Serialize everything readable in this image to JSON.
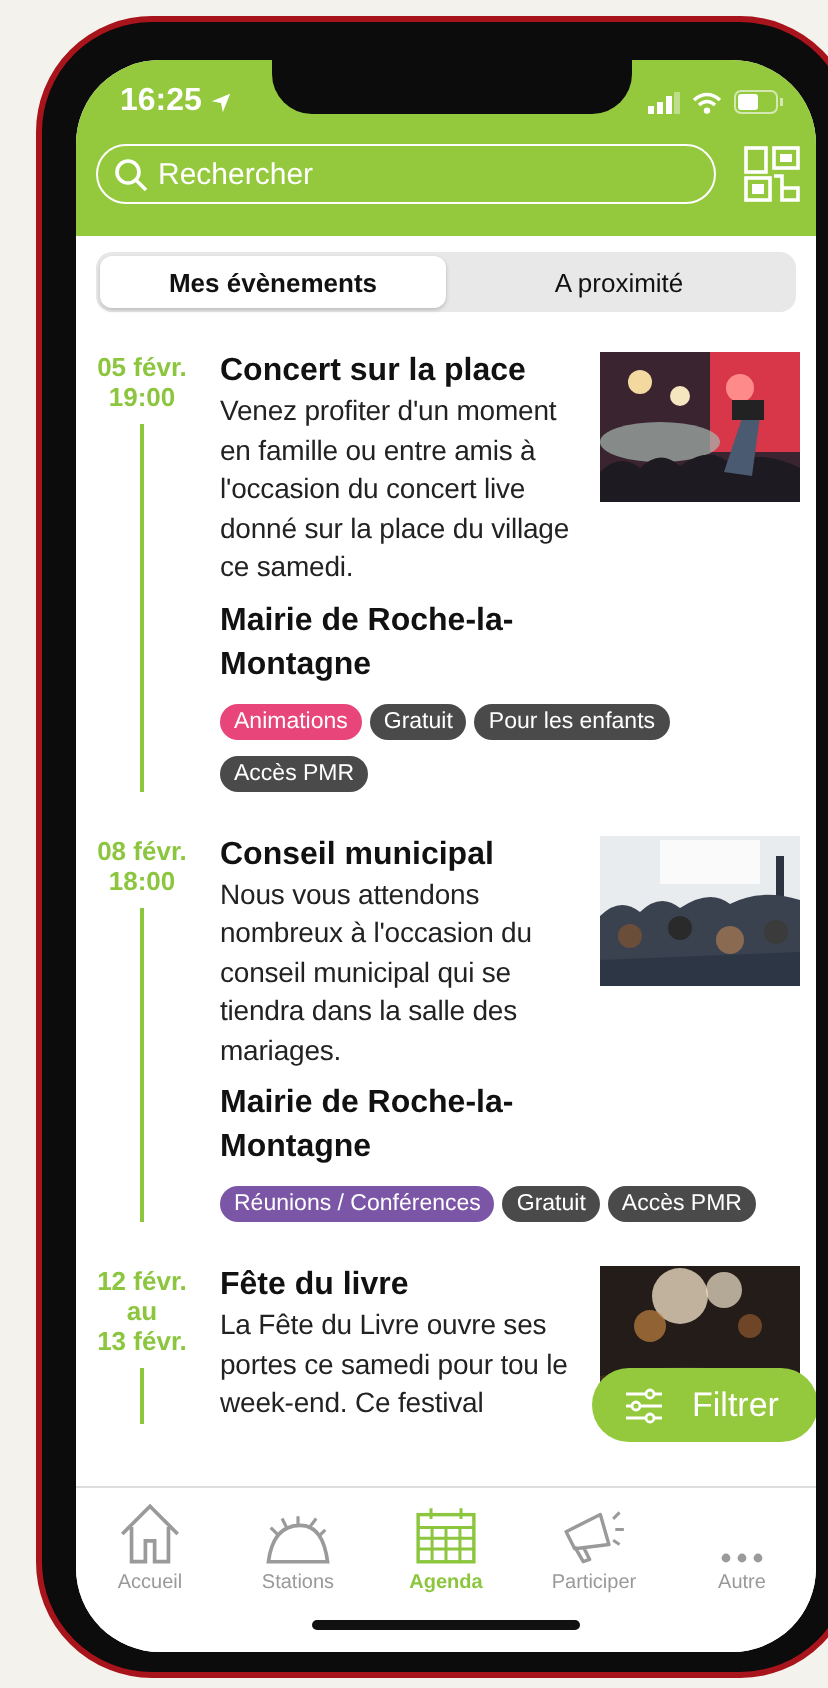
{
  "status_bar": {
    "time": "16:25"
  },
  "search": {
    "placeholder": "Rechercher"
  },
  "segments": [
    {
      "label": "Mes évènements",
      "selected": true
    },
    {
      "label": "A proximité",
      "selected": false
    }
  ],
  "events": [
    {
      "date": "05 févr.",
      "time": "19:00",
      "title": "Concert sur la place",
      "description": "Venez profiter d'un moment en famille ou entre amis à l'occasion du concert live donné sur la place du village ce samedi.",
      "organizer": "Mairie de Roche-la-Montagne",
      "tags": [
        {
          "label": "Animations",
          "color": "#e8457a"
        },
        {
          "label": "Gratuit",
          "color": "#4a4a4a"
        },
        {
          "label": "Pour les enfants",
          "color": "#4a4a4a"
        },
        {
          "label": "Accès PMR",
          "color": "#4a4a4a"
        }
      ],
      "image": {
        "kind": "picture"
      }
    },
    {
      "date": "08 févr.",
      "time": "18:00",
      "title": "Conseil municipal",
      "description": "Nous vous attendons nombreux à l'occasion du conseil municipal qui se tiendra dans la salle des mariages.",
      "organizer": "Mairie de Roche-la-Montagne",
      "tags": [
        {
          "label": "Réunions / Conférences",
          "color": "#7b55a6"
        },
        {
          "label": "Gratuit",
          "color": "#4a4a4a"
        },
        {
          "label": "Accès PMR",
          "color": "#4a4a4a"
        }
      ],
      "image": {
        "kind": "picture"
      }
    },
    {
      "date": "12 févr.",
      "date_joiner": "au",
      "date_end": "13 févr.",
      "title": "Fête du livre",
      "description": "La Fête du Livre ouvre ses portes ce samedi pour tou le week-end. Ce festival",
      "image": {
        "kind": "picture"
      }
    }
  ],
  "filter_button": {
    "label": "Filtrer"
  },
  "tab_bar": [
    {
      "label": "Accueil",
      "selected": false
    },
    {
      "label": "Stations",
      "selected": false
    },
    {
      "label": "Agenda",
      "selected": true
    },
    {
      "label": "Participer",
      "selected": false
    },
    {
      "label": "Autre",
      "selected": false
    }
  ]
}
